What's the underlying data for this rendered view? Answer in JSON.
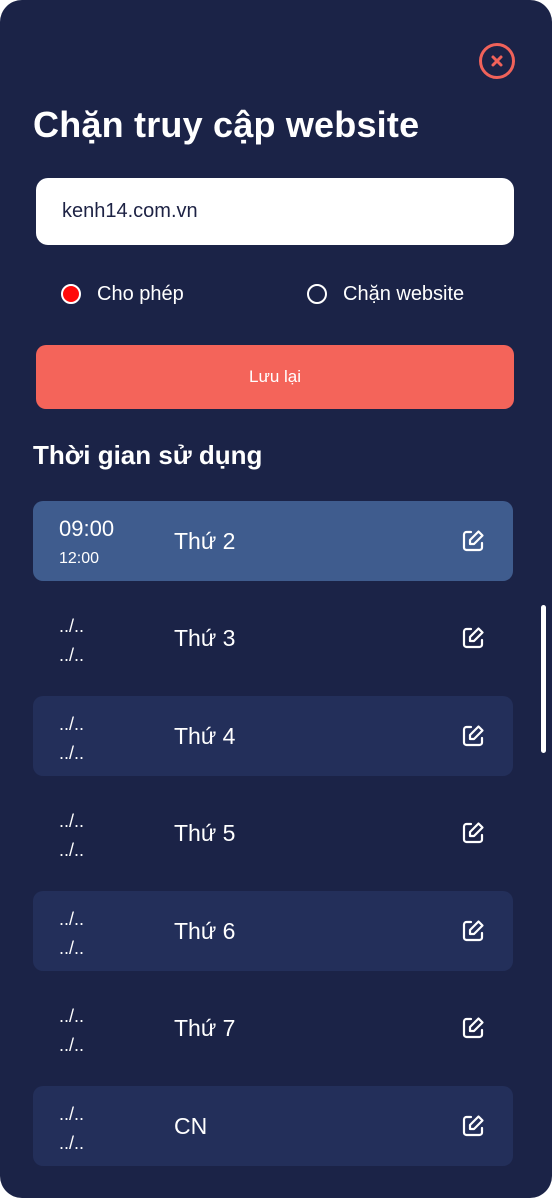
{
  "dialog": {
    "title": "Chặn truy cập website",
    "close_icon": "close-icon",
    "url_input": {
      "value": "kenh14.com.vn",
      "placeholder": ""
    },
    "mode_options": [
      {
        "label": "Cho phép",
        "selected": true
      },
      {
        "label": "Chặn website",
        "selected": false
      }
    ],
    "save_label": "Lưu lại",
    "section_title": "Thời gian sử dụng",
    "schedule": [
      {
        "start": "09:00",
        "end": "12:00",
        "day": "Thứ 2"
      },
      {
        "start": "../..",
        "end": "../..",
        "day": "Thứ 3"
      },
      {
        "start": "../..",
        "end": "../..",
        "day": "Thứ 4"
      },
      {
        "start": "../..",
        "end": "../..",
        "day": "Thứ 5"
      },
      {
        "start": "../..",
        "end": "../..",
        "day": "Thứ 6"
      },
      {
        "start": "../..",
        "end": "../..",
        "day": "Thứ 7"
      },
      {
        "start": "../..",
        "end": "../..",
        "day": "CN"
      }
    ],
    "edit_icon": "edit-icon"
  },
  "colors": {
    "background": "#1b2347",
    "accent": "#f4645a",
    "row_shaded": "#232f5a",
    "row_active": "#3f5c8e",
    "radio_selected": "#ff0a0a"
  }
}
